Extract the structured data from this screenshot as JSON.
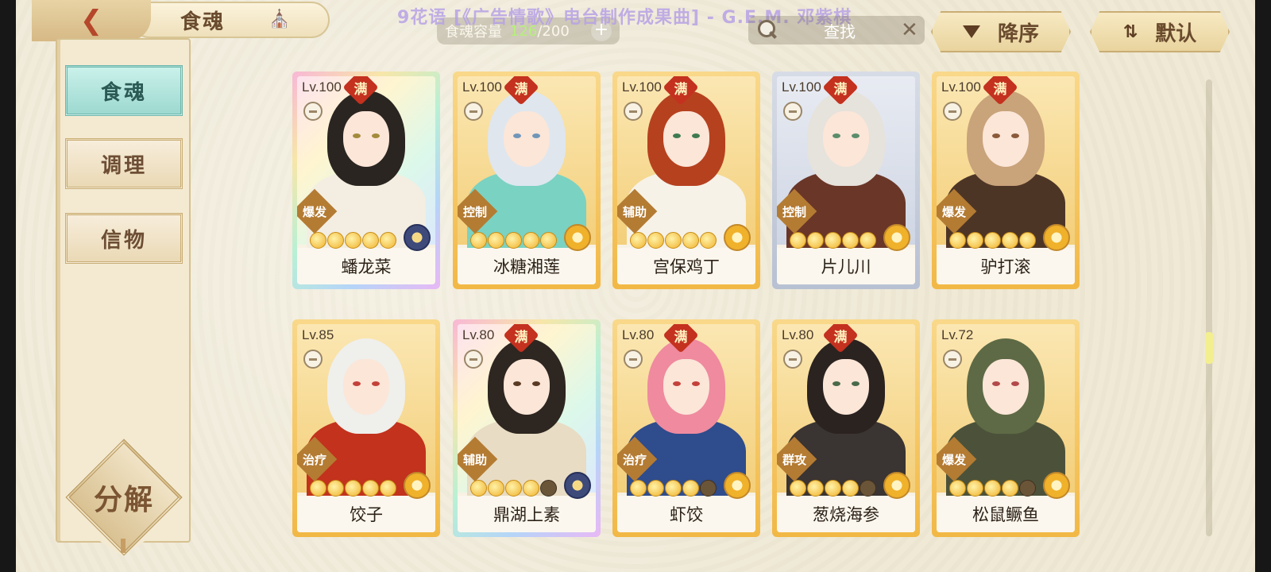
{
  "header": {
    "back_icon": "back-arrow-icon",
    "title": "食魂",
    "pavilion_icon": "pavilion-icon",
    "watermark": "9花语 [《广告情歌》电台制作成果曲] - G.E.M. 邓紫棋",
    "capacity": {
      "label": "食魂容量",
      "current": "126",
      "max": "/200"
    },
    "search_placeholder": "查找",
    "sort_desc_label": "降序",
    "sort_default_label": "默认"
  },
  "sidebar": {
    "items": [
      {
        "label": "食魂",
        "active": true
      },
      {
        "label": "调理",
        "active": false
      },
      {
        "label": "信物",
        "active": false
      }
    ],
    "decompose_label": "分解"
  },
  "cards": [
    {
      "level": "Lv.100",
      "maxed": "满",
      "role": "爆发",
      "name": "蟠龙菜",
      "frame": "rainbow",
      "stars": 5,
      "element": "dark",
      "hair": "#2a2521",
      "robe": "#f3eee1",
      "eyes": "#a38b3c"
    },
    {
      "level": "Lv.100",
      "maxed": "满",
      "role": "控制",
      "name": "冰糖湘莲",
      "frame": "gold",
      "stars": 5,
      "element": "gold",
      "hair": "#dfe6ee",
      "robe": "#7ad2c2",
      "eyes": "#7096b8"
    },
    {
      "level": "Lv.100",
      "maxed": "满",
      "role": "辅助",
      "name": "宫保鸡丁",
      "frame": "gold",
      "stars": 5,
      "element": "gold",
      "hair": "#b6411f",
      "robe": "#f6f2e8",
      "eyes": "#3f7a4f"
    },
    {
      "level": "Lv.100",
      "maxed": "满",
      "role": "控制",
      "name": "片儿川",
      "frame": "silver",
      "stars": 5,
      "element": "gold",
      "hair": "#e6e2dc",
      "robe": "#6a3628",
      "eyes": "#5b8d6b"
    },
    {
      "level": "Lv.100",
      "maxed": "满",
      "role": "爆发",
      "name": "驴打滚",
      "frame": "gold",
      "stars": 5,
      "element": "gold",
      "hair": "#c9a37a",
      "robe": "#4d3526",
      "eyes": "#8a5a3a"
    },
    {
      "level": "Lv.85",
      "maxed": "",
      "role": "治疗",
      "name": "饺子",
      "frame": "gold",
      "stars": 5,
      "element": "gold",
      "hair": "#efefec",
      "robe": "#c2321d",
      "eyes": "#c4413a"
    },
    {
      "level": "Lv.80",
      "maxed": "满",
      "role": "辅助",
      "name": "鼎湖上素",
      "frame": "rainbow",
      "stars": 4,
      "element": "dark",
      "hair": "#2e2620",
      "robe": "#e8dcc4",
      "eyes": "#5a3a22"
    },
    {
      "level": "Lv.80",
      "maxed": "满",
      "role": "治疗",
      "name": "虾饺",
      "frame": "gold",
      "stars": 4,
      "element": "gold",
      "hair": "#ef8a9f",
      "robe": "#2f4c8c",
      "eyes": "#c4413a"
    },
    {
      "level": "Lv.80",
      "maxed": "满",
      "role": "群攻",
      "name": "葱烧海参",
      "frame": "gold",
      "stars": 4,
      "element": "gold",
      "hair": "#2b2320",
      "robe": "#3a3432",
      "eyes": "#4a6a4a"
    },
    {
      "level": "Lv.72",
      "maxed": "",
      "role": "爆发",
      "name": "松鼠鳜鱼",
      "frame": "gold",
      "stars": 4,
      "element": "gold",
      "hair": "#5e6a45",
      "robe": "#4c523a",
      "eyes": "#b34a4a"
    }
  ],
  "colors": {
    "background": "#efe9d6",
    "accent_teal": "#9dd9d0",
    "gold": "#f2b845",
    "capacity_current": "#b5f07a"
  }
}
